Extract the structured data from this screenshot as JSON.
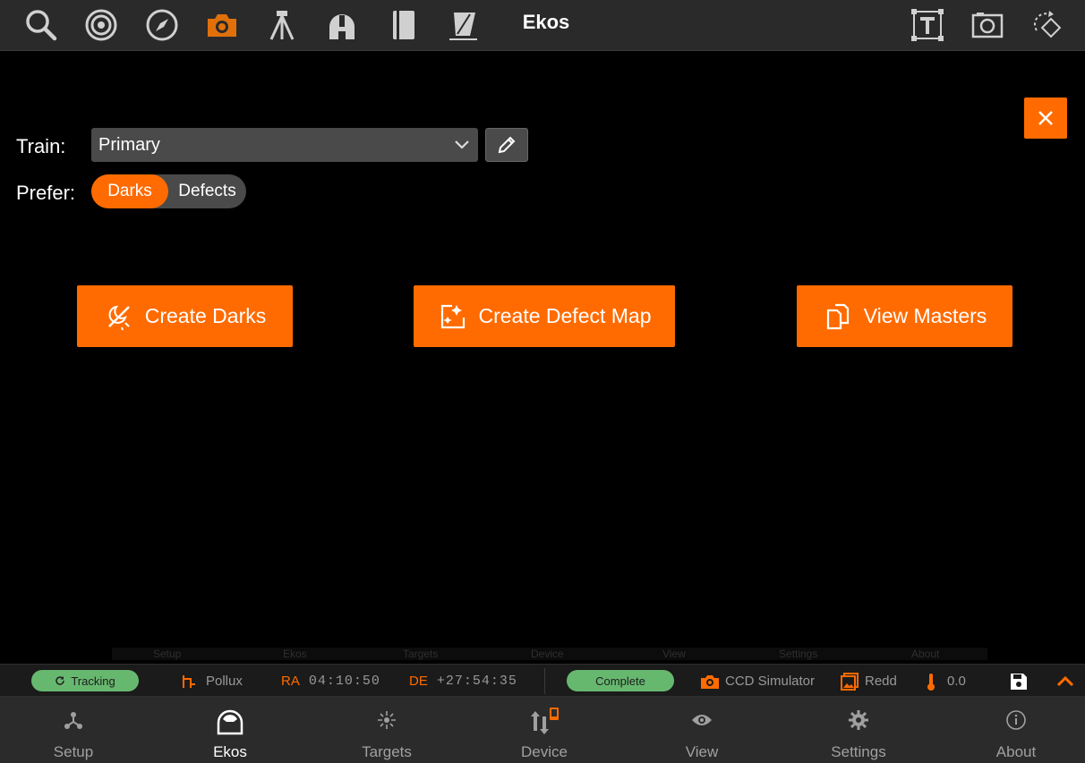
{
  "toolbar": {
    "title": "Ekos",
    "icons": [
      "search-icon",
      "target-icon",
      "compass-icon",
      "camera-icon",
      "tripod-icon",
      "observatory-icon",
      "notebook-icon",
      "flat-panel-icon",
      "text-frame-icon",
      "frame-camera-icon",
      "rotate-icon"
    ],
    "active_icon": "camera-icon"
  },
  "form": {
    "train_label": "Train:",
    "train_value": "Primary",
    "prefer_label": "Prefer:",
    "prefer_options": [
      "Darks",
      "Defects"
    ],
    "prefer_selected": "Darks"
  },
  "actions": {
    "create_darks": "Create Darks",
    "create_defect_map": "Create Defect Map",
    "view_masters": "View Masters"
  },
  "ghost_tabs": [
    "Setup",
    "Ekos",
    "Targets",
    "Device",
    "View",
    "Settings",
    "About"
  ],
  "status": {
    "tracking": "Tracking",
    "target": "Pollux",
    "ra_label": "RA",
    "ra_value": "04:10:50",
    "de_label": "DE",
    "de_value": "+27:54:35",
    "capture_state": "Complete",
    "camera": "CCD Simulator",
    "filter": "Redd",
    "temperature": "0.0"
  },
  "nav": {
    "items": [
      "Setup",
      "Ekos",
      "Targets",
      "Device",
      "View",
      "Settings",
      "About"
    ],
    "active": "Ekos"
  },
  "colors": {
    "accent": "#ff6b00",
    "status_green": "#67b86f",
    "bar_dark": "#2a2a2a",
    "background": "#000000"
  }
}
